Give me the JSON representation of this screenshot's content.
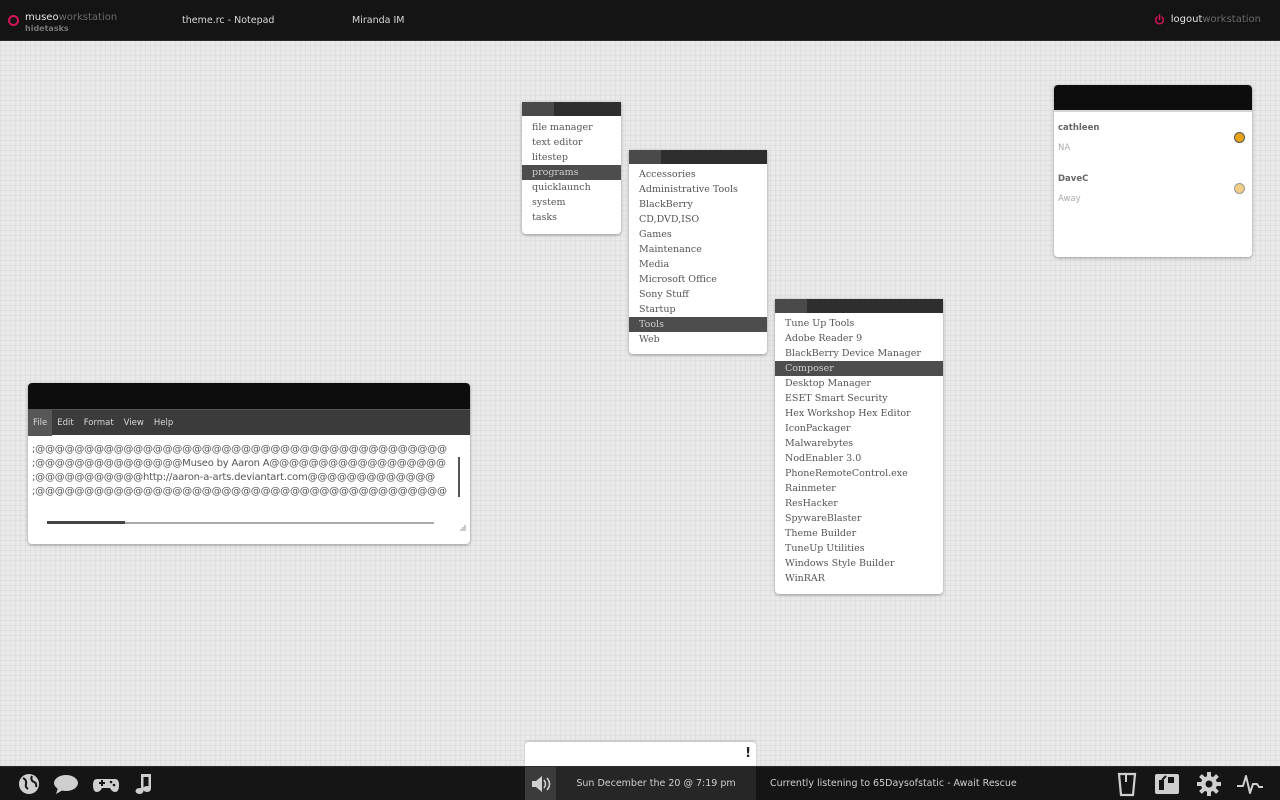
{
  "colors": {
    "accent": "#d4145a",
    "bar": "#141414",
    "menu_highlight": "#4d4d4d"
  },
  "topbar": {
    "brand_primary": "museo",
    "brand_secondary": "workstation",
    "brand_sub": "hidetasks",
    "tasks": [
      "theme.rc - Notepad",
      "Miranda IM"
    ],
    "logout_primary": "logout",
    "logout_secondary": "workstation"
  },
  "menu_main": {
    "items": [
      "file manager",
      "text editor",
      "litestep",
      "programs",
      "quicklaunch",
      "system",
      "tasks"
    ],
    "active_index": 3
  },
  "menu_programs": {
    "items": [
      "Accessories",
      "Administrative Tools",
      "BlackBerry",
      "CD,DVD,ISO",
      "Games",
      "Maintenance",
      "Media",
      "Microsoft Office",
      "Sony Stuff",
      "Startup",
      "Tools",
      "Web"
    ],
    "active_index": 10
  },
  "menu_tools": {
    "items": [
      "Tune Up Tools",
      "Adobe Reader 9",
      "BlackBerry Device Manager",
      "Composer",
      "Desktop Manager",
      "ESET Smart Security",
      "Hex Workshop Hex Editor",
      "IconPackager",
      "Malwarebytes",
      "NodEnabler 3.0",
      "PhoneRemoteControl.exe",
      "Rainmeter",
      "ResHacker",
      "SpywareBlaster",
      "Theme Builder",
      "TuneUp Utilities",
      "Windows Style Builder",
      "WinRAR"
    ],
    "active_index": 3
  },
  "miranda": {
    "contacts": [
      {
        "name": "cathleen",
        "status": "NA",
        "color": "#e8a317"
      },
      {
        "name": "DaveC",
        "status": "Away",
        "color": "#f0cd85"
      }
    ]
  },
  "notepad": {
    "menu": [
      "File",
      "Edit",
      "Format",
      "View",
      "Help"
    ],
    "active_menu": 0,
    "lines": [
      ";@@@@@@@@@@@@@@@@@@@@@@@@@@@@@@@@@@@@@@@@@@",
      ";@@@@@@@@@@@@@@@Museo by Aaron A@@@@@@@@@@@@@@@@@@",
      ";@@@@@@@@@@@http://aaron-a-arts.deviantart.com@@@@@@@@@@@@@",
      ";@@@@@@@@@@@@@@@@@@@@@@@@@@@@@@@@@@@@@@@@@@"
    ]
  },
  "notification": {
    "mark": "!"
  },
  "taskbar": {
    "left_icons": [
      "globe-icon",
      "chat-bubble-icon",
      "gamepad-icon",
      "music-note-icon"
    ],
    "right_icons": [
      "trash-icon",
      "dashboard-icon",
      "gear-icon",
      "activity-icon"
    ],
    "volume_icon": "speaker-icon",
    "clock": "Sun December the 20 @ 7:19 pm",
    "now_playing": "Currently listening to 65Daysofstatic - Await Rescue"
  }
}
